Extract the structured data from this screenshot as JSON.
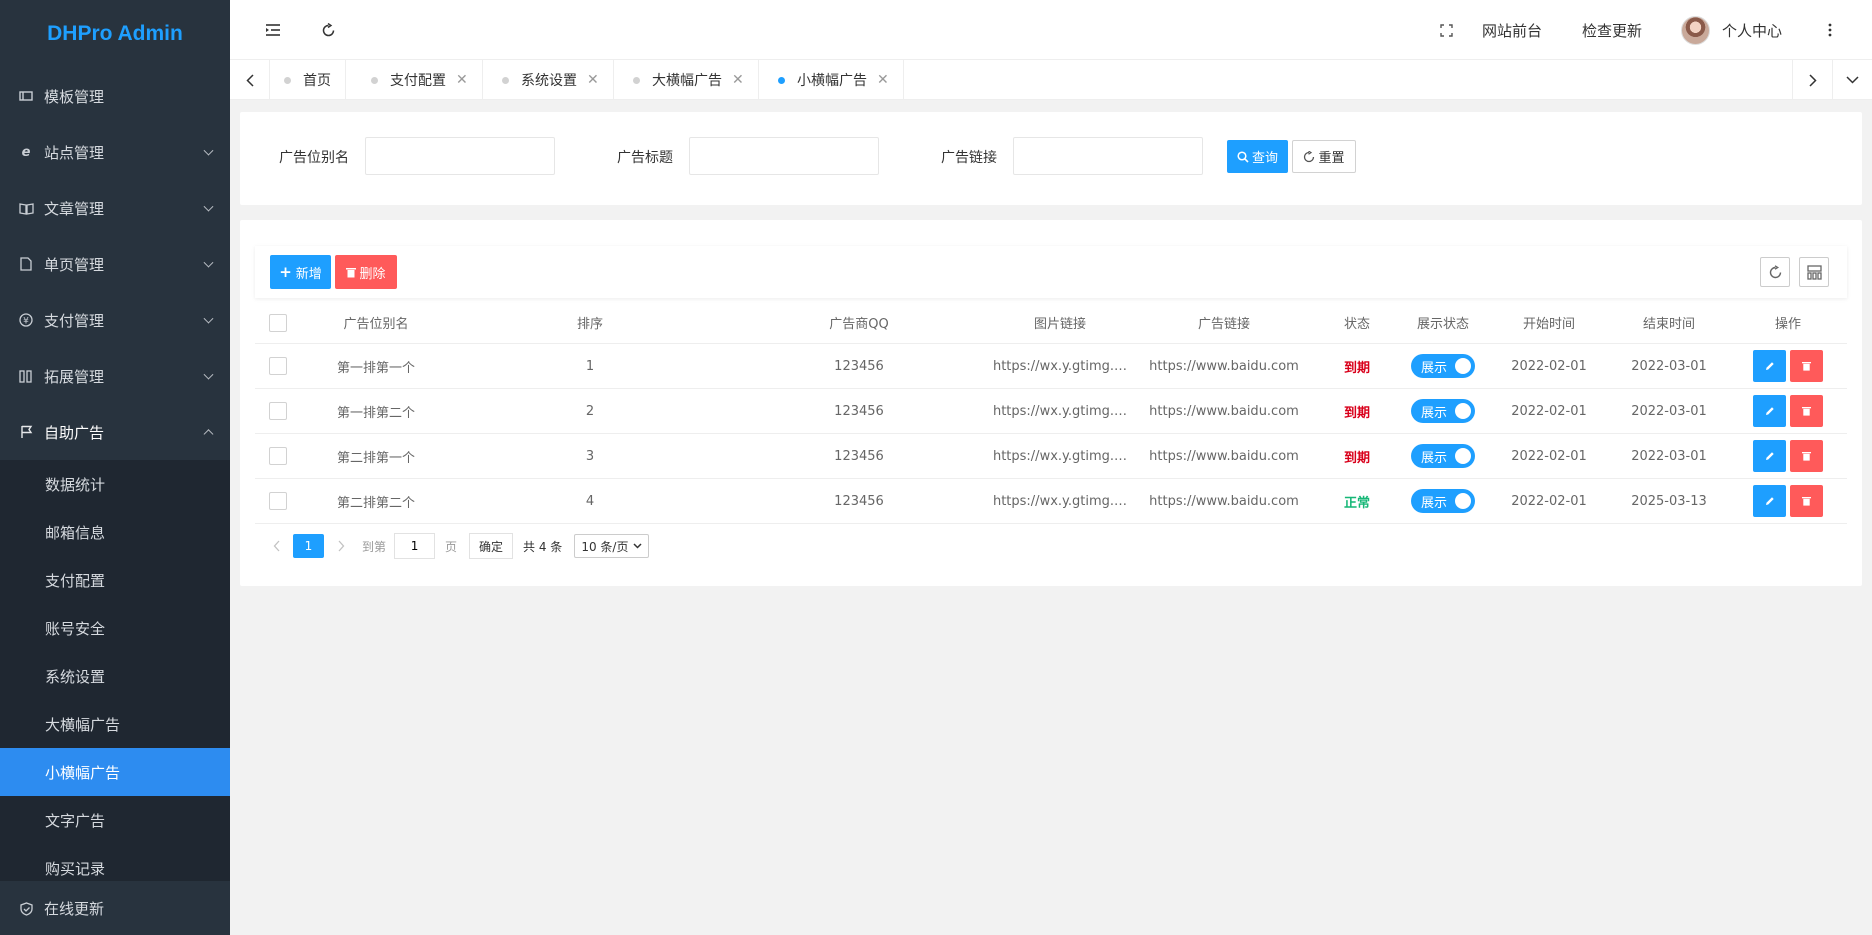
{
  "brand": "DHPro Admin",
  "sidebar": {
    "items": [
      {
        "label": "模板管理",
        "icon": "template-icon"
      },
      {
        "label": "站点管理",
        "icon": "ie-icon"
      },
      {
        "label": "文章管理",
        "icon": "book-icon"
      },
      {
        "label": "单页管理",
        "icon": "file-icon"
      },
      {
        "label": "支付管理",
        "icon": "yen-icon"
      },
      {
        "label": "拓展管理",
        "icon": "extension-icon"
      },
      {
        "label": "自助广告",
        "icon": "flag-icon"
      }
    ],
    "submenu": [
      "数据统计",
      "邮箱信息",
      "支付配置",
      "账号安全",
      "系统设置",
      "大横幅广告",
      "小横幅广告",
      "文字广告",
      "购买记录"
    ],
    "active_sub": "小横幅广告",
    "bottom": {
      "label": "在线更新",
      "icon": "shield-icon"
    }
  },
  "header": {
    "site_front": "网站前台",
    "check_update": "检查更新",
    "personal": "个人中心"
  },
  "tabs": [
    {
      "label": "首页",
      "closable": false
    },
    {
      "label": "支付配置",
      "closable": true
    },
    {
      "label": "系统设置",
      "closable": true
    },
    {
      "label": "大横幅广告",
      "closable": true
    },
    {
      "label": "小横幅广告",
      "closable": true,
      "active": true
    }
  ],
  "search": {
    "alias_label": "广告位别名",
    "title_label": "广告标题",
    "link_label": "广告链接",
    "query_btn": "查询",
    "reset_btn": "重置"
  },
  "toolbar": {
    "add": "新增",
    "delete": "删除"
  },
  "table": {
    "headers": [
      "广告位别名",
      "排序",
      "广告商QQ",
      "图片链接",
      "广告链接",
      "状态",
      "展示状态",
      "开始时间",
      "结束时间",
      "操作"
    ],
    "rows": [
      {
        "alias": "第一排第一个",
        "sort": "1",
        "qq": "123456",
        "img": "https://wx.y.gtimg.…",
        "link": "https://www.baidu.com",
        "status": "到期",
        "show": "展示",
        "start": "2022-02-01",
        "end": "2022-03-01"
      },
      {
        "alias": "第一排第二个",
        "sort": "2",
        "qq": "123456",
        "img": "https://wx.y.gtimg.…",
        "link": "https://www.baidu.com",
        "status": "到期",
        "show": "展示",
        "start": "2022-02-01",
        "end": "2022-03-01"
      },
      {
        "alias": "第二排第一个",
        "sort": "3",
        "qq": "123456",
        "img": "https://wx.y.gtimg.…",
        "link": "https://www.baidu.com",
        "status": "到期",
        "show": "展示",
        "start": "2022-02-01",
        "end": "2022-03-01"
      },
      {
        "alias": "第二排第二个",
        "sort": "4",
        "qq": "123456",
        "img": "https://wx.y.gtimg.…",
        "link": "https://www.baidu.com",
        "status": "正常",
        "show": "展示",
        "start": "2022-02-01",
        "end": "2025-03-13"
      }
    ]
  },
  "pagination": {
    "current": "1",
    "goto_label": "到第",
    "page_input": "1",
    "page_suffix": "页",
    "confirm": "确定",
    "total": "共 4 条",
    "page_size": "10 条/页"
  },
  "colors": {
    "accent": "#1e9fff",
    "danger": "#ff5a5a",
    "expired": "#d9001b",
    "normal": "#16b777",
    "sidebar": "#28333e"
  }
}
